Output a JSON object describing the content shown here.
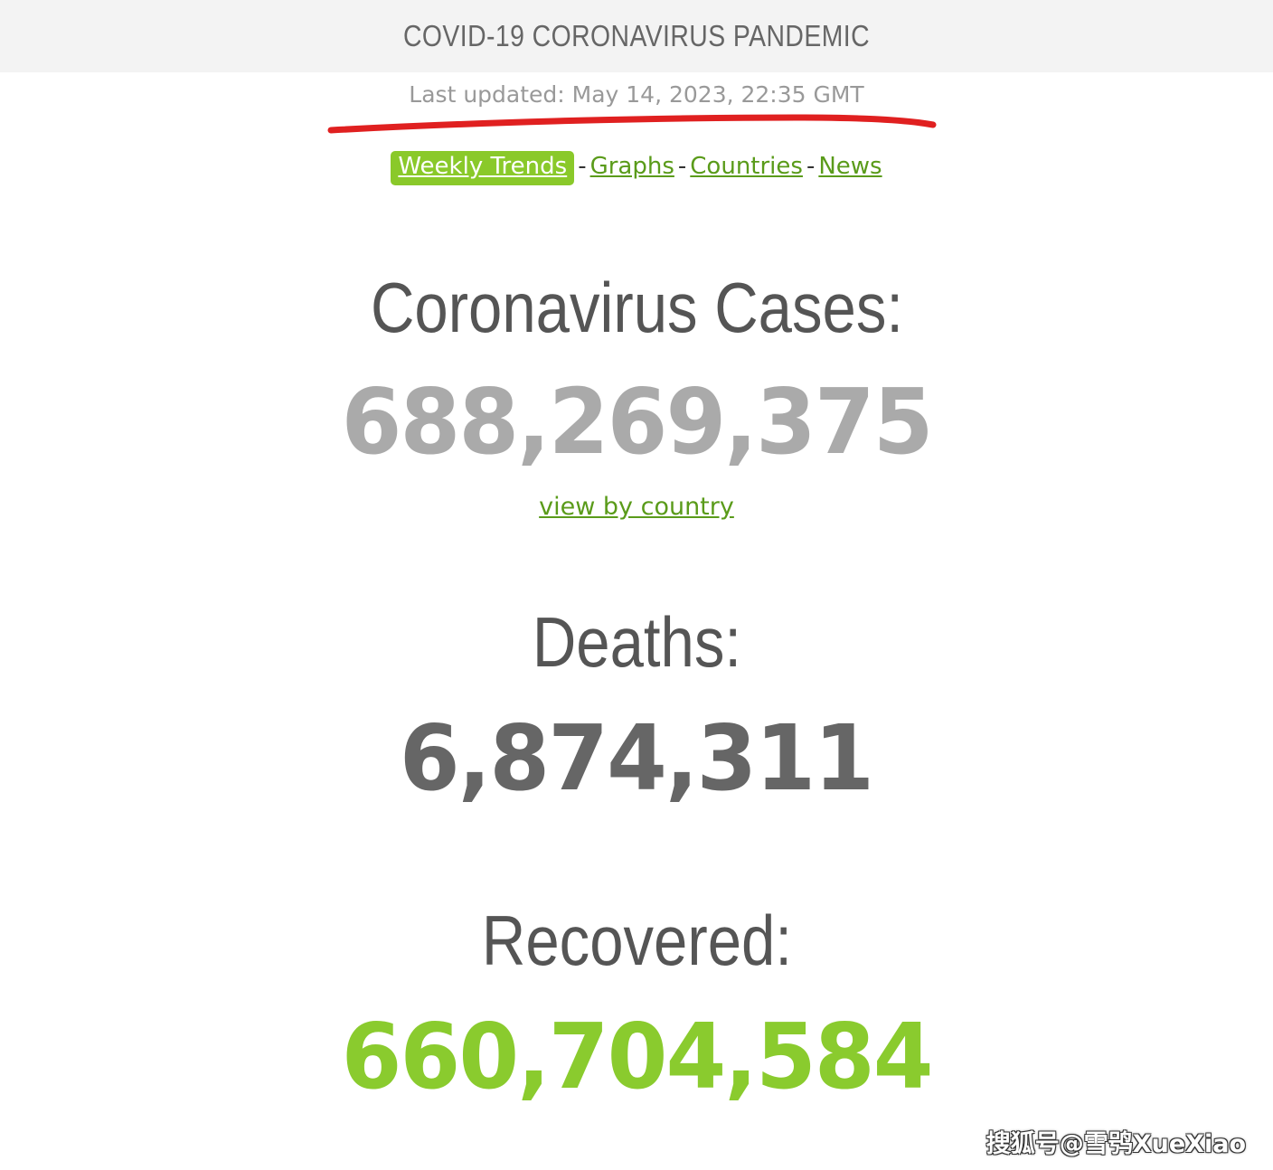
{
  "header": {
    "title": "COVID-19 CORONAVIRUS PANDEMIC"
  },
  "last_updated": "Last updated: May 14, 2023, 22:35 GMT",
  "annotation": {
    "underline_color": "#e02020"
  },
  "nav": {
    "items": [
      {
        "label": "Weekly Trends",
        "active": true
      },
      {
        "label": "Graphs",
        "active": false
      },
      {
        "label": "Countries",
        "active": false
      },
      {
        "label": "News",
        "active": false
      }
    ],
    "separator": "-"
  },
  "stats": {
    "cases": {
      "label": "Coronavirus Cases:",
      "value": "688,269,375",
      "color": "#aaaaaa"
    },
    "view_link": "view by country",
    "deaths": {
      "label": "Deaths:",
      "value": "6,874,311",
      "color": "#666666"
    },
    "recovered": {
      "label": "Recovered:",
      "value": "660,704,584",
      "color": "#8acb2e"
    }
  },
  "colors": {
    "link": "#5a9b1a",
    "active_tab_bg": "#8ac92a",
    "topbar_bg": "#f3f3f3"
  },
  "watermark": "搜狐号@雪鸮XueXiao"
}
